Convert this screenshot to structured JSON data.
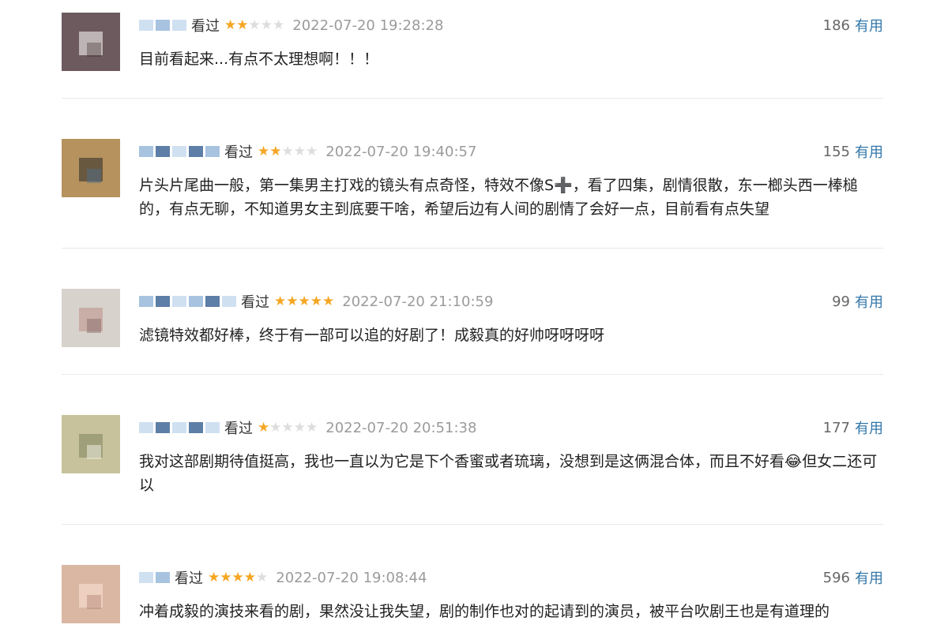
{
  "comments": [
    {
      "status": "看过",
      "rating": 2,
      "time": "2022-07-20 19:28:28",
      "votes": "186",
      "useful_label": "有用",
      "text": "目前看起来...有点不太理想啊！！！",
      "avatar_color": "#6d5a5e"
    },
    {
      "status": "看过",
      "rating": 2,
      "time": "2022-07-20 19:40:57",
      "votes": "155",
      "useful_label": "有用",
      "text": "片头片尾曲一般，第一集男主打戏的镜头有点奇怪，特效不像S➕，看了四集，剧情很散，东一榔头西一棒槌的，有点无聊，不知道男女主到底要干啥，希望后边有人间的剧情了会好一点，目前看有点失望",
      "avatar_color": "#b6925e"
    },
    {
      "status": "看过",
      "rating": 5,
      "time": "2022-07-20 21:10:59",
      "votes": "99",
      "useful_label": "有用",
      "text": "滤镜特效都好棒，终于有一部可以追的好剧了！成毅真的好帅呀呀呀呀",
      "avatar_color": "#d8d2cc"
    },
    {
      "status": "看过",
      "rating": 1,
      "time": "2022-07-20 20:51:38",
      "votes": "177",
      "useful_label": "有用",
      "text": "我对这部剧期待值挺高，我也一直以为它是下个香蜜或者琉璃，没想到是这俩混合体，而且不好看😂但女二还可以",
      "avatar_color": "#c7c29b"
    },
    {
      "status": "看过",
      "rating": 4,
      "time": "2022-07-20 19:08:44",
      "votes": "596",
      "useful_label": "有用",
      "text": "冲着成毅的演技来看的剧，果然没让我失望，剧的制作也对的起请到的演员，被平台吹剧王也是有道理的",
      "avatar_color": "#d9b7a3"
    }
  ]
}
